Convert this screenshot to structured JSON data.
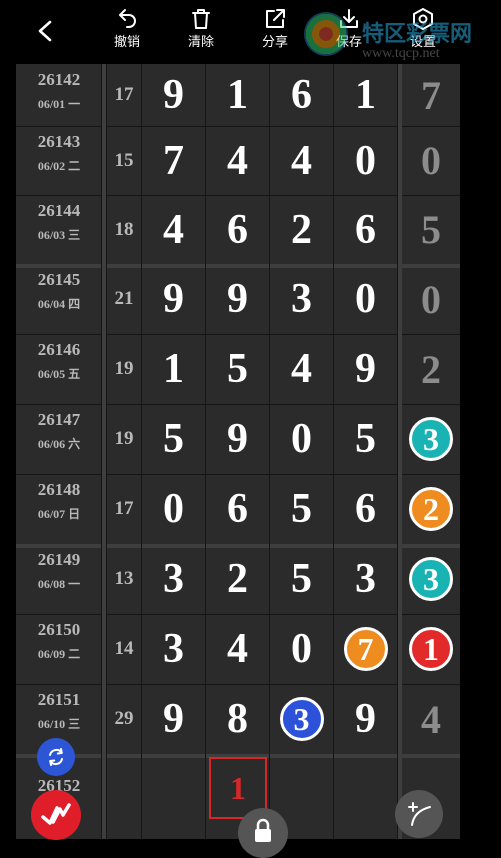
{
  "toolbar": {
    "undo_label": "撤销",
    "clear_label": "清除",
    "share_label": "分享",
    "save_label": "保存",
    "settings_label": "设置"
  },
  "watermark": {
    "text": "特区彩票网",
    "url": "www.tqcp.net"
  },
  "rows": [
    {
      "issue": "26142",
      "date": "06/01 一",
      "sum": "17",
      "d1": "9",
      "d2": "1",
      "d3": "6",
      "d4": "1",
      "x": "7",
      "x_style": "plain"
    },
    {
      "issue": "26143",
      "date": "06/02 二",
      "sum": "15",
      "d1": "7",
      "d2": "4",
      "d3": "4",
      "d4": "0",
      "x": "0",
      "x_style": "plain"
    },
    {
      "issue": "26144",
      "date": "06/03 三",
      "sum": "18",
      "d1": "4",
      "d2": "6",
      "d3": "2",
      "d4": "6",
      "x": "5",
      "x_style": "plain"
    },
    {
      "issue": "26145",
      "date": "06/04 四",
      "sum": "21",
      "d1": "9",
      "d2": "9",
      "d3": "3",
      "d4": "0",
      "x": "0",
      "x_style": "plain"
    },
    {
      "issue": "26146",
      "date": "06/05 五",
      "sum": "19",
      "d1": "1",
      "d2": "5",
      "d3": "4",
      "d4": "9",
      "x": "2",
      "x_style": "plain"
    },
    {
      "issue": "26147",
      "date": "06/06 六",
      "sum": "19",
      "d1": "5",
      "d2": "9",
      "d3": "0",
      "d4": "5",
      "x": "3",
      "x_style": "teal"
    },
    {
      "issue": "26148",
      "date": "06/07 日",
      "sum": "17",
      "d1": "0",
      "d2": "6",
      "d3": "5",
      "d4": "6",
      "x": "2",
      "x_style": "orange"
    },
    {
      "issue": "26149",
      "date": "06/08 一",
      "sum": "13",
      "d1": "3",
      "d2": "2",
      "d3": "5",
      "d4": "3",
      "x": "3",
      "x_style": "teal"
    },
    {
      "issue": "26150",
      "date": "06/09 二",
      "sum": "14",
      "d1": "3",
      "d2": "4",
      "d3": "0",
      "d4": "7",
      "x": "1",
      "x_style": "red"
    },
    {
      "issue": "26151",
      "date": "06/10 三",
      "sum": "29",
      "d1": "9",
      "d2": "8",
      "d3": "3",
      "d4": "9",
      "x": "4",
      "x_style": "plain"
    }
  ],
  "circled": [
    {
      "row": 8,
      "col": "d4",
      "color": "orange"
    },
    {
      "row": 9,
      "col": "d3",
      "color": "blue"
    }
  ],
  "pending_row": {
    "issue": "26152",
    "pending_digit": "1"
  },
  "colors": {
    "teal": "#1ab3b3",
    "orange": "#ef8c1f",
    "red": "#e22a2a",
    "blue": "#2b52d8",
    "pending": "#d62828"
  }
}
